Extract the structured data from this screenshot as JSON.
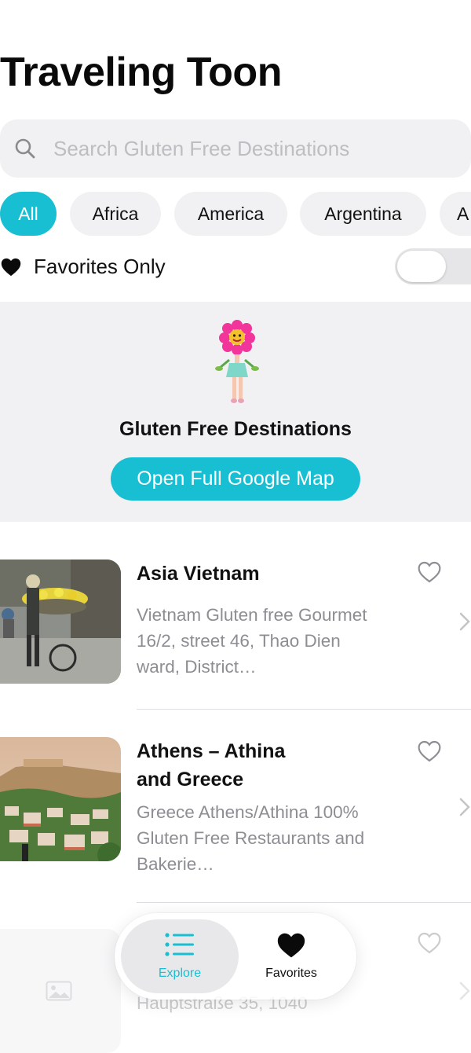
{
  "app": {
    "title": "Traveling Toon"
  },
  "search": {
    "placeholder": "Search Gluten Free Destinations",
    "value": ""
  },
  "categories": [
    {
      "label": "All",
      "selected": true
    },
    {
      "label": "Africa",
      "selected": false
    },
    {
      "label": "America",
      "selected": false
    },
    {
      "label": "Argentina",
      "selected": false
    },
    {
      "label": "A",
      "selected": false
    }
  ],
  "favorites_filter": {
    "label": "Favorites Only",
    "enabled": false
  },
  "map_banner": {
    "title": "Gluten Free Destinations",
    "button_label": "Open Full Google Map"
  },
  "destinations": [
    {
      "title": "Asia Vietnam",
      "description": "Vietnam Gluten free Gourmet 16/2, street 46, Thao Dien ward, District…",
      "favorited": false
    },
    {
      "title_line1": "Athens – Athina",
      "title_line2": "and Greece",
      "description": "Greece Athens/Athina 100% Gluten Free Restaurants and Bakerie…",
      "favorited": false
    },
    {
      "description_partial": "Hauptstraße 35, 1040",
      "favorited": false
    }
  ],
  "tab_bar": {
    "tabs": [
      {
        "label": "Explore",
        "icon": "list-icon",
        "selected": true
      },
      {
        "label": "Favorites",
        "icon": "heart-icon",
        "selected": false
      }
    ]
  },
  "colors": {
    "accent": "#18bfd2",
    "chip_bg": "#f1f1f3",
    "secondary_text": "#8d8d93"
  }
}
